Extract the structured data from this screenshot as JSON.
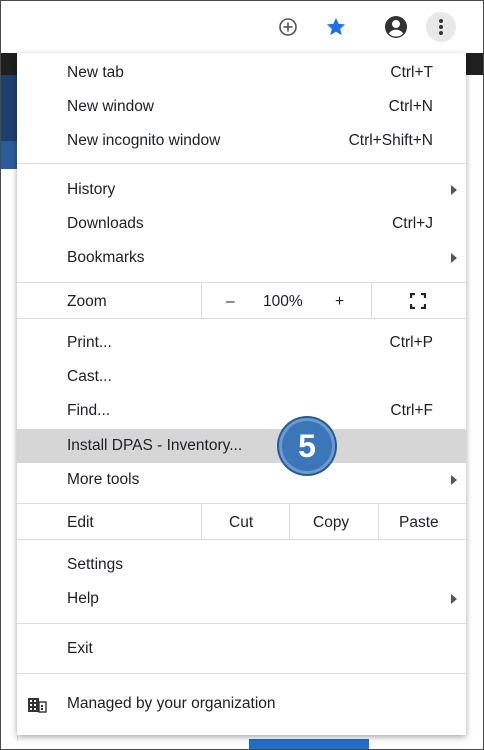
{
  "colors": {
    "accent_star": "#1a73e8",
    "highlight": "#d6d6d6",
    "badge": "#3a76b8"
  },
  "toolbar": {
    "icons": [
      "zoom-plus-icon",
      "bookmark-star-icon",
      "account-icon",
      "more-vert-icon"
    ]
  },
  "menu": {
    "new_tab": {
      "label": "New tab",
      "shortcut": "Ctrl+T"
    },
    "new_window": {
      "label": "New window",
      "shortcut": "Ctrl+N"
    },
    "new_incognito": {
      "label": "New incognito window",
      "shortcut": "Ctrl+Shift+N"
    },
    "history": {
      "label": "History"
    },
    "downloads": {
      "label": "Downloads",
      "shortcut": "Ctrl+J"
    },
    "bookmarks": {
      "label": "Bookmarks"
    },
    "zoom": {
      "label": "Zoom",
      "minus": "–",
      "value": "100%",
      "plus": "+"
    },
    "print": {
      "label": "Print...",
      "shortcut": "Ctrl+P"
    },
    "cast": {
      "label": "Cast..."
    },
    "find": {
      "label": "Find...",
      "shortcut": "Ctrl+F"
    },
    "install": {
      "label": "Install DPAS - Inventory..."
    },
    "more_tools": {
      "label": "More tools"
    },
    "edit": {
      "label": "Edit",
      "cut": "Cut",
      "copy": "Copy",
      "paste": "Paste"
    },
    "settings": {
      "label": "Settings"
    },
    "help": {
      "label": "Help"
    },
    "exit": {
      "label": "Exit"
    },
    "managed": {
      "label": "Managed by your organization"
    }
  },
  "step_badge": "5"
}
